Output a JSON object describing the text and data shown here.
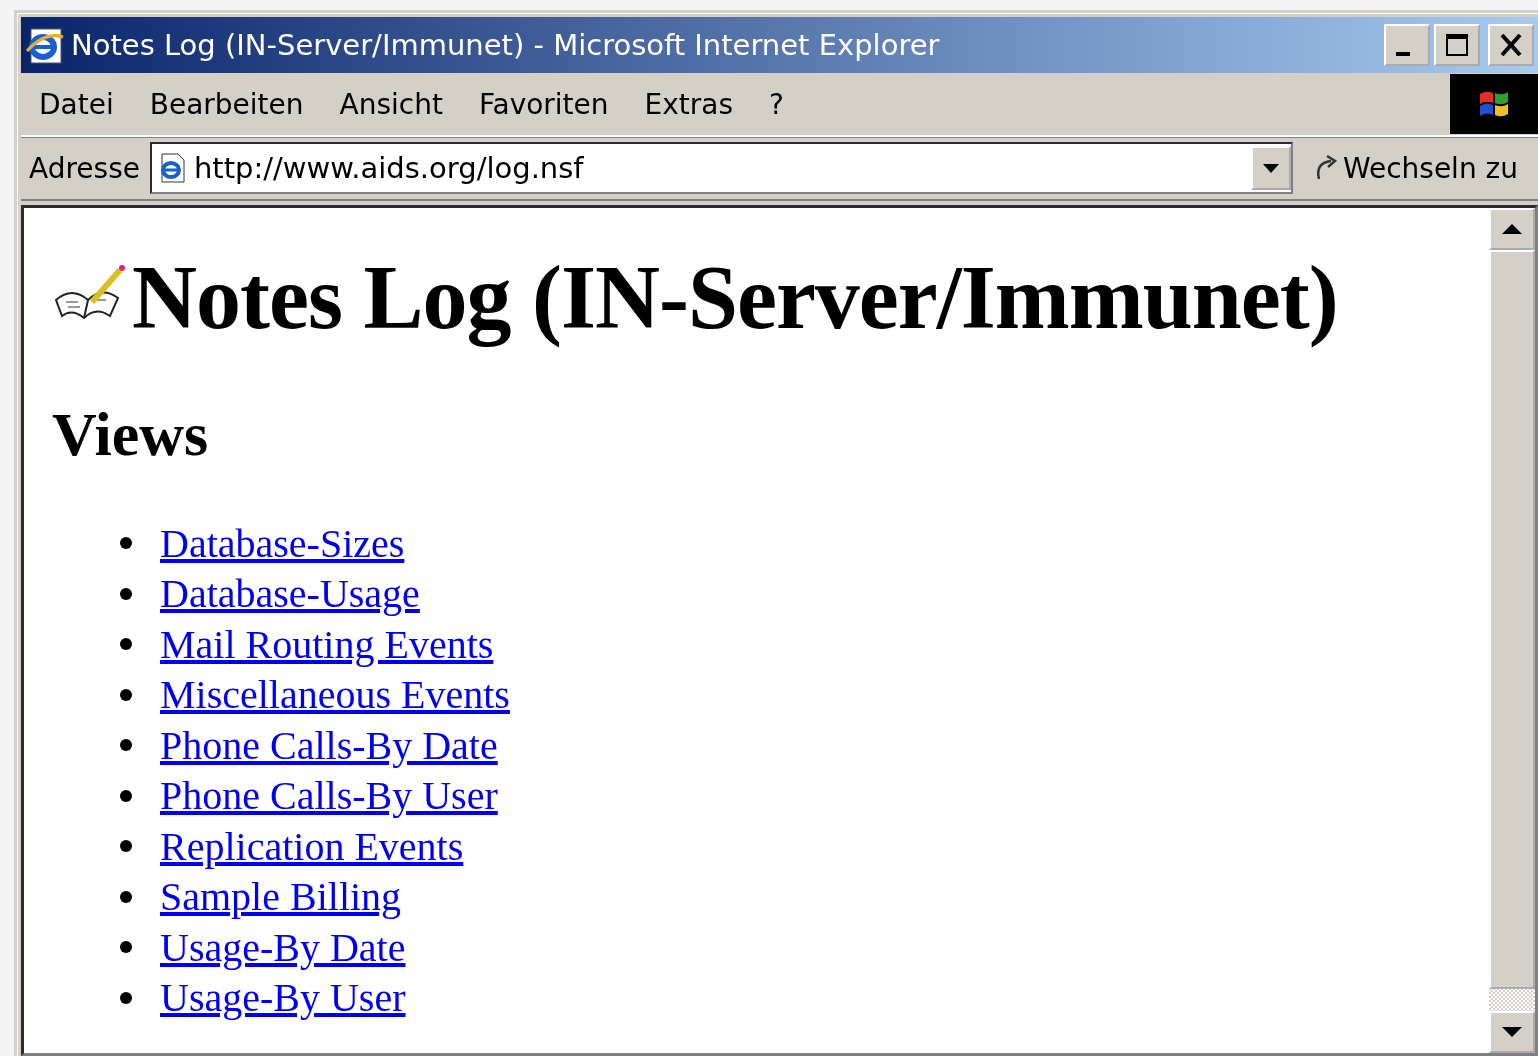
{
  "window": {
    "title": "Notes Log (IN-Server/Immunet) - Microsoft Internet Explorer"
  },
  "menu": [
    "Datei",
    "Bearbeiten",
    "Ansicht",
    "Favoriten",
    "Extras",
    "?"
  ],
  "address_bar": {
    "label": "Adresse",
    "value": "http://www.aids.org/log.nsf",
    "go_button": "Wechseln zu"
  },
  "page": {
    "heading": "Notes Log (IN-Server/Immunet)",
    "section": "Views",
    "links": [
      "Database-Sizes",
      "Database-Usage",
      "Mail Routing Events",
      "Miscellaneous Events",
      "Phone Calls-By Date",
      "Phone Calls-By User",
      "Replication Events",
      "Sample Billing",
      "Usage-By Date",
      "Usage-By User"
    ]
  }
}
